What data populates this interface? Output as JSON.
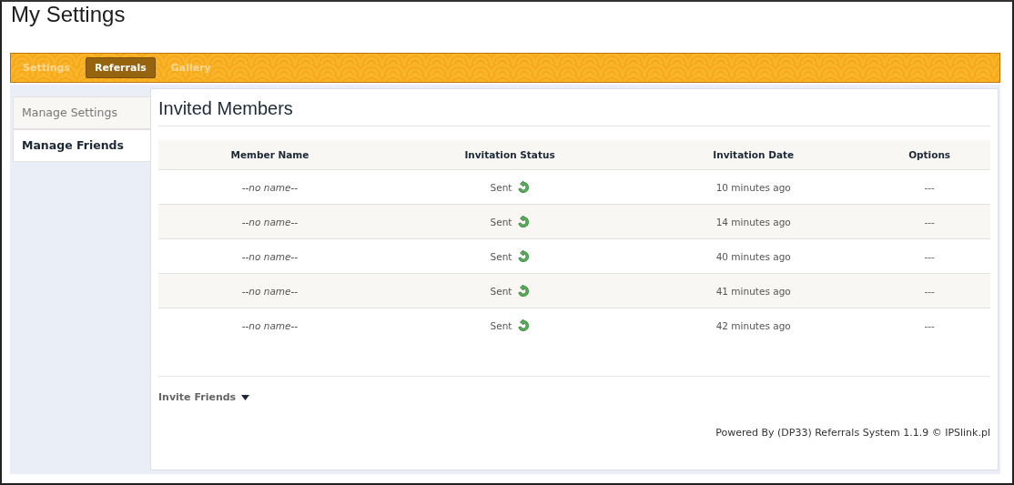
{
  "page_title": "My Settings",
  "tabs": [
    {
      "label": "Settings",
      "selected": false
    },
    {
      "label": "Referrals",
      "selected": true
    },
    {
      "label": "Gallery",
      "selected": false
    }
  ],
  "sidebar": {
    "items": [
      {
        "label": "Manage Settings",
        "selected": false
      },
      {
        "label": "Manage Friends",
        "selected": true
      }
    ]
  },
  "section_title": "Invited Members",
  "table": {
    "columns": [
      "Member Name",
      "Invitation Status",
      "Invitation Date",
      "Options"
    ],
    "rows": [
      {
        "member_name": "--no name--",
        "status": "Sent",
        "date": "10 minutes ago",
        "options": "---"
      },
      {
        "member_name": "--no name--",
        "status": "Sent",
        "date": "14 minutes ago",
        "options": "---"
      },
      {
        "member_name": "--no name--",
        "status": "Sent",
        "date": "40 minutes ago",
        "options": "---"
      },
      {
        "member_name": "--no name--",
        "status": "Sent",
        "date": "41 minutes ago",
        "options": "---"
      },
      {
        "member_name": "--no name--",
        "status": "Sent",
        "date": "42 minutes ago",
        "options": "---"
      }
    ]
  },
  "invite_menu": "Invite Friends",
  "footer": "Powered By (DP33) Referrals System 1.1.9 © IPSlink.pl"
}
